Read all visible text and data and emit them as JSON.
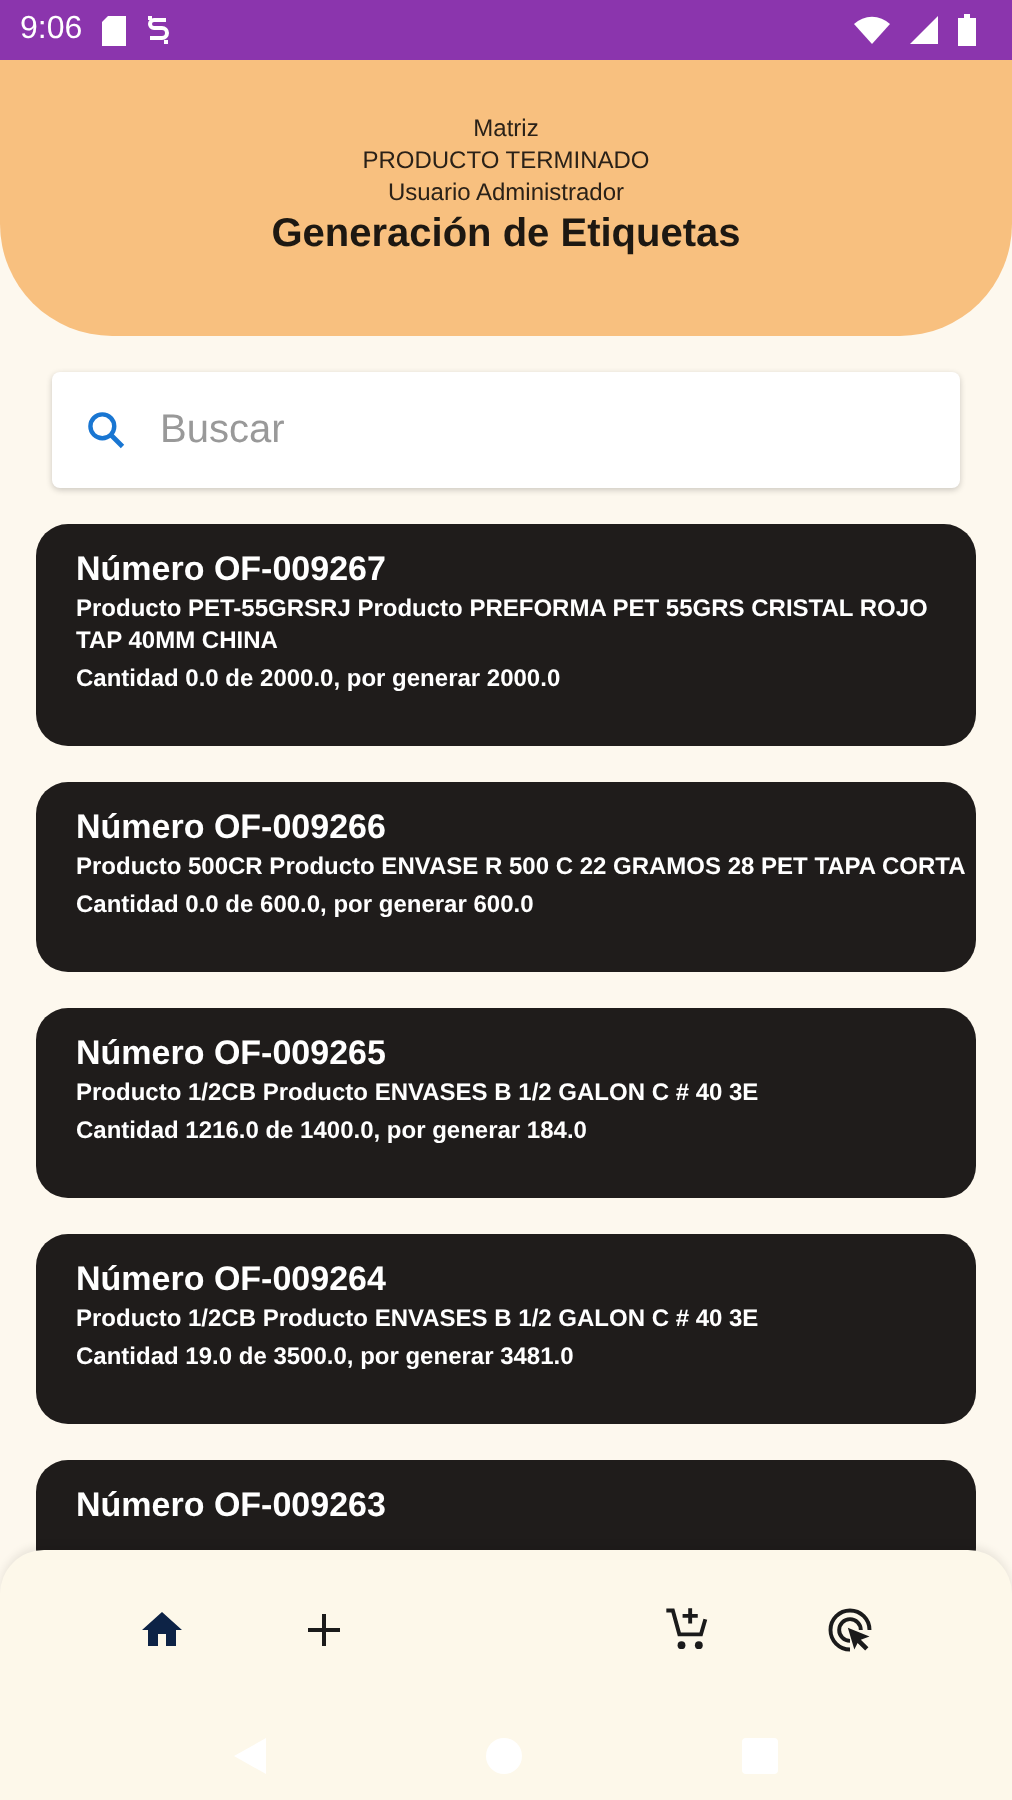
{
  "status_bar": {
    "time": "9:06"
  },
  "header": {
    "lines": [
      "Matriz",
      "PRODUCTO TERMINADO",
      "Usuario Administrador"
    ],
    "title": "Generación de Etiquetas"
  },
  "search": {
    "placeholder": "Buscar"
  },
  "orders": [
    {
      "number": "Número OF-009267",
      "product": "Producto PET-55GRSRJ Producto PREFORMA PET 55GRS CRISTAL ROJO TAP 40MM CHINA",
      "quantity": "Cantidad 0.0 de 2000.0, por generar 2000.0"
    },
    {
      "number": "Número OF-009266",
      "product": "Producto 500CR Producto ENVASE R 500 C 22 GRAMOS 28 PET TAPA CORTA",
      "quantity": "Cantidad 0.0 de 600.0, por generar 600.0"
    },
    {
      "number": "Número OF-009265",
      "product": "Producto 1/2CB Producto ENVASES B 1/2 GALON C # 40 3E",
      "quantity": "Cantidad 1216.0 de 1400.0, por generar 184.0"
    },
    {
      "number": "Número OF-009264",
      "product": "Producto 1/2CB Producto ENVASES B 1/2 GALON C # 40 3E",
      "quantity": "Cantidad 19.0 de 3500.0, por generar 3481.0"
    },
    {
      "number": "Número OF-009263"
    }
  ],
  "bottom_nav": [
    {
      "kind": "home",
      "selected": true
    },
    {
      "kind": "add",
      "selected": false
    },
    {
      "kind": "spacer"
    },
    {
      "kind": "cart",
      "selected": false
    },
    {
      "kind": "click",
      "selected": false
    }
  ]
}
